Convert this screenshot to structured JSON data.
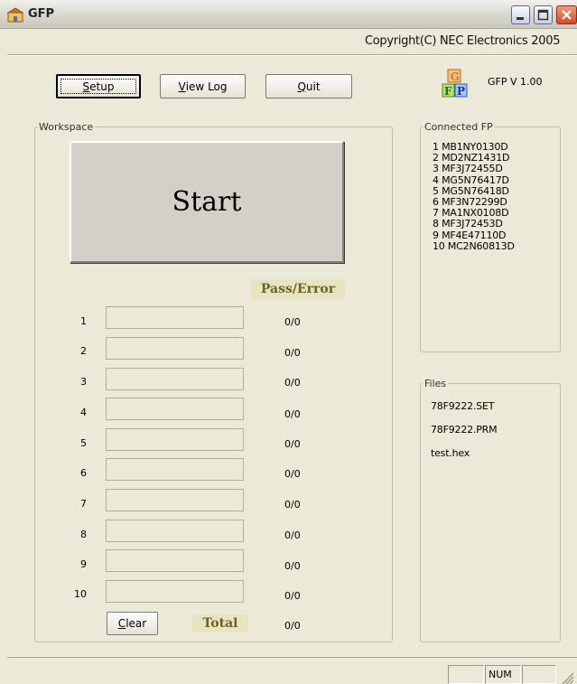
{
  "window": {
    "title": "GFP"
  },
  "header": {
    "copyright": "Copyright(C) NEC Electronics 2005",
    "version": "GFP V 1.00"
  },
  "toolbar": {
    "setup": {
      "label": "Setup",
      "accel": "S",
      "rest": "etup"
    },
    "viewlog": {
      "label": "View Log",
      "accel": "V",
      "rest": "iew Log"
    },
    "quit": {
      "label": "Quit",
      "accel": "Q",
      "rest": "uit"
    }
  },
  "workspace": {
    "label": "Workspace",
    "start_label": "Start",
    "pass_error_label": "Pass/Error",
    "rows": [
      {
        "num": "1",
        "value": "0/0"
      },
      {
        "num": "2",
        "value": "0/0"
      },
      {
        "num": "3",
        "value": "0/0"
      },
      {
        "num": "4",
        "value": "0/0"
      },
      {
        "num": "5",
        "value": "0/0"
      },
      {
        "num": "6",
        "value": "0/0"
      },
      {
        "num": "7",
        "value": "0/0"
      },
      {
        "num": "8",
        "value": "0/0"
      },
      {
        "num": "9",
        "value": "0/0"
      },
      {
        "num": "10",
        "value": "0/0"
      }
    ],
    "clear": {
      "label": "Clear",
      "accel": "C",
      "rest": "lear"
    },
    "total_label": "Total",
    "total_value": "0/0"
  },
  "connected": {
    "label": "Connected FP",
    "items": [
      "1 MB1NY0130D",
      "2 MD2NZ1431D",
      "3 MF3J72455D",
      "4 MG5N76417D",
      "5 MG5N76418D",
      "6 MF3N72299D",
      "7 MA1NX0108D",
      "8 MF3J72453D",
      "9 MF4E47110D",
      "10 MC2N60813D"
    ]
  },
  "files": {
    "label": "Files",
    "items": [
      "78F9222.SET",
      "78F9222.PRM",
      "test.hex"
    ]
  },
  "statusbar": {
    "num_indicator": "NUM"
  },
  "logo": {
    "letters": [
      "G",
      "F",
      "P"
    ]
  },
  "icons": {
    "app": "app-icon",
    "minimize": "minimize-icon",
    "maximize": "maximize-icon",
    "close": "close-icon"
  }
}
